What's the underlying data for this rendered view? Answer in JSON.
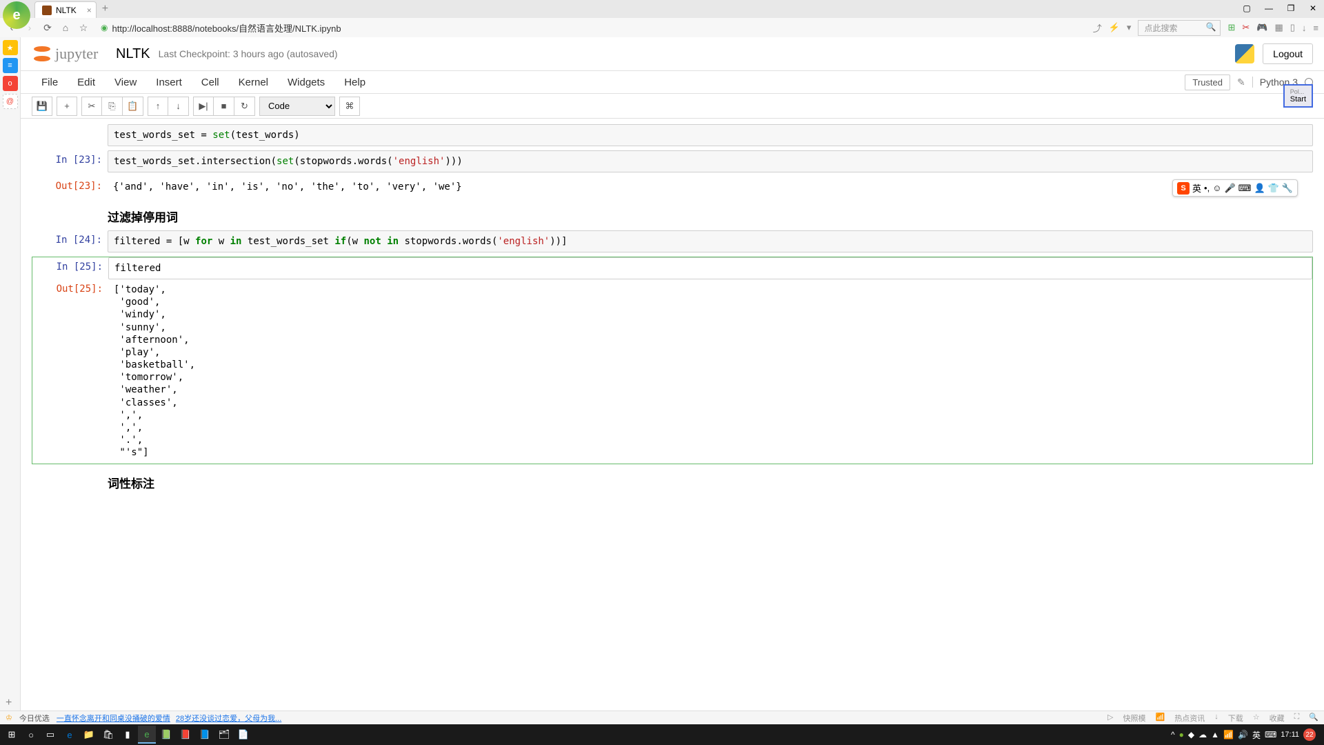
{
  "browser": {
    "tab_title": "NLTK",
    "url": "http://localhost:8888/notebooks/自然语言处理/NLTK.ipynb",
    "search_placeholder": "点此搜索"
  },
  "window_controls": {
    "reader": "▢",
    "min": "—",
    "max": "❐",
    "close": "✕"
  },
  "jupyter": {
    "logo_text": "jupyter",
    "title": "NLTK",
    "checkpoint": "Last Checkpoint: 3 hours ago (autosaved)",
    "logout": "Logout",
    "trusted": "Trusted",
    "kernel": "Python 3"
  },
  "menu": [
    "File",
    "Edit",
    "View",
    "Insert",
    "Cell",
    "Kernel",
    "Widgets",
    "Help"
  ],
  "toolbar": {
    "cell_type": "Code"
  },
  "cells": {
    "c22_partial": "test_words_set = set(test_words)",
    "c23": {
      "prompt_in": "In [23]:",
      "code": "test_words_set.intersection(set(stopwords.words('english')))",
      "prompt_out": "Out[23]:",
      "output": "{'and', 'have', 'in', 'is', 'no', 'the', 'to', 'very', 'we'}"
    },
    "md1": "过滤掉停用词",
    "c24": {
      "prompt_in": "In [24]:",
      "code_raw": "filtered = [w for w in test_words_set if(w not in stopwords.words('english'))]"
    },
    "c25": {
      "prompt_in": "In [25]:",
      "code": "filtered",
      "prompt_out": "Out[25]:",
      "output": "['today',\n 'good',\n 'windy',\n 'sunny',\n 'afternoon',\n 'play',\n 'basketball',\n 'tomorrow',\n 'weather',\n 'classes',\n ',',\n ',',\n '.',\n \"'s\"]"
    },
    "md2": "词性标注"
  },
  "ime": {
    "lang": "英",
    "punct": "•,"
  },
  "float": {
    "top_label": "Pol...",
    "start": "Start"
  },
  "status_bar": {
    "today": "今日优选",
    "links": [
      "一直怀念离开和同桌没捅破的爱情",
      "28岁还没谈过恋爱，父母为我..."
    ],
    "right": [
      "快照模",
      "热点资讯",
      "下载",
      "收藏"
    ]
  },
  "tray": {
    "time": "17:11",
    "notif_count": "22"
  }
}
